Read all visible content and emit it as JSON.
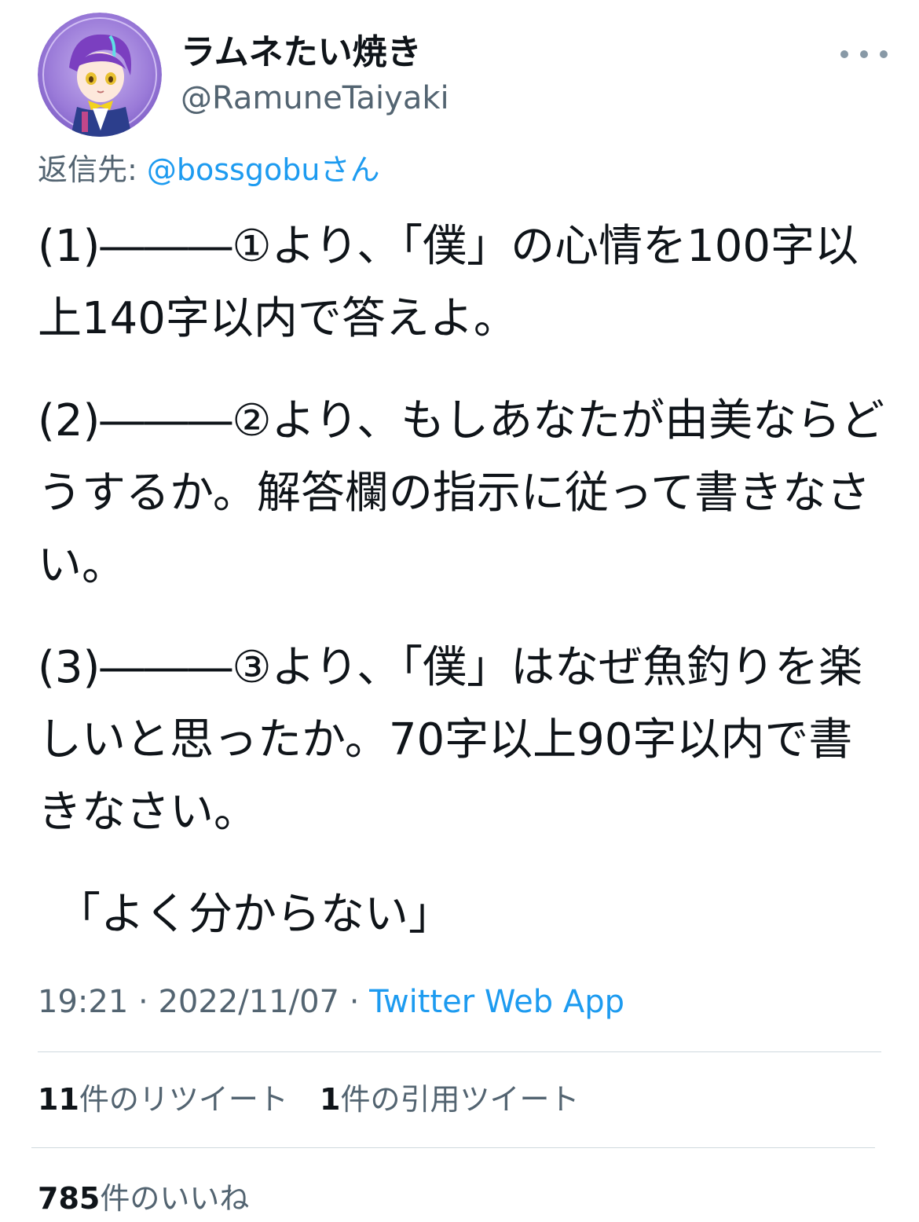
{
  "tweet": {
    "author": {
      "display_name": "ラムネたい焼き",
      "handle": "@RamuneTaiyaki",
      "avatar_icon": "avatar-illustration"
    },
    "more_icon": "more-horizontal-icon",
    "reply_to": {
      "prefix": "返信先: ",
      "mention": "@bossgobu",
      "suffix": "さん"
    },
    "paragraphs": [
      "(1)―――①より、「僕」の心情を100字以上140字以内で答えよ。",
      "(2)―――②より、もしあなたが由美ならどうするか。解答欄の指示に従って書きなさい。",
      "(3)―――③より、「僕」はなぜ魚釣りを楽しいと思ったか。70字以上90字以内で書きなさい。",
      "「よく分からない」"
    ],
    "time": "19:21",
    "date": "2022/11/07",
    "separator": " · ",
    "source": "Twitter Web App",
    "stats": {
      "retweets_count": "11",
      "retweets_label": "件のリツイート",
      "quotes_count": "1",
      "quotes_label": "件の引用ツイート",
      "likes_count": "785",
      "likes_label": "件のいいね"
    }
  },
  "colors": {
    "text": "#0f1419",
    "secondary": "#536471",
    "link": "#1d9bf0",
    "divider": "#cfd9de"
  }
}
